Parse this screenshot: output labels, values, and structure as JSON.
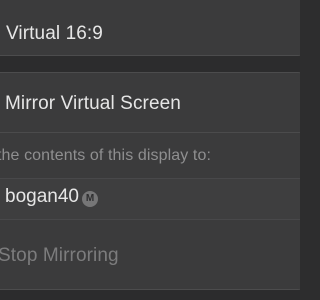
{
  "menu": {
    "display_mode": "Virtual 16:9",
    "mirror_option": "Mirror Virtual Screen",
    "section_label": "the contents of this display to:",
    "target_device": {
      "name": "bogan40",
      "badge": "M"
    },
    "stop_mirroring": "Stop Mirroring"
  }
}
